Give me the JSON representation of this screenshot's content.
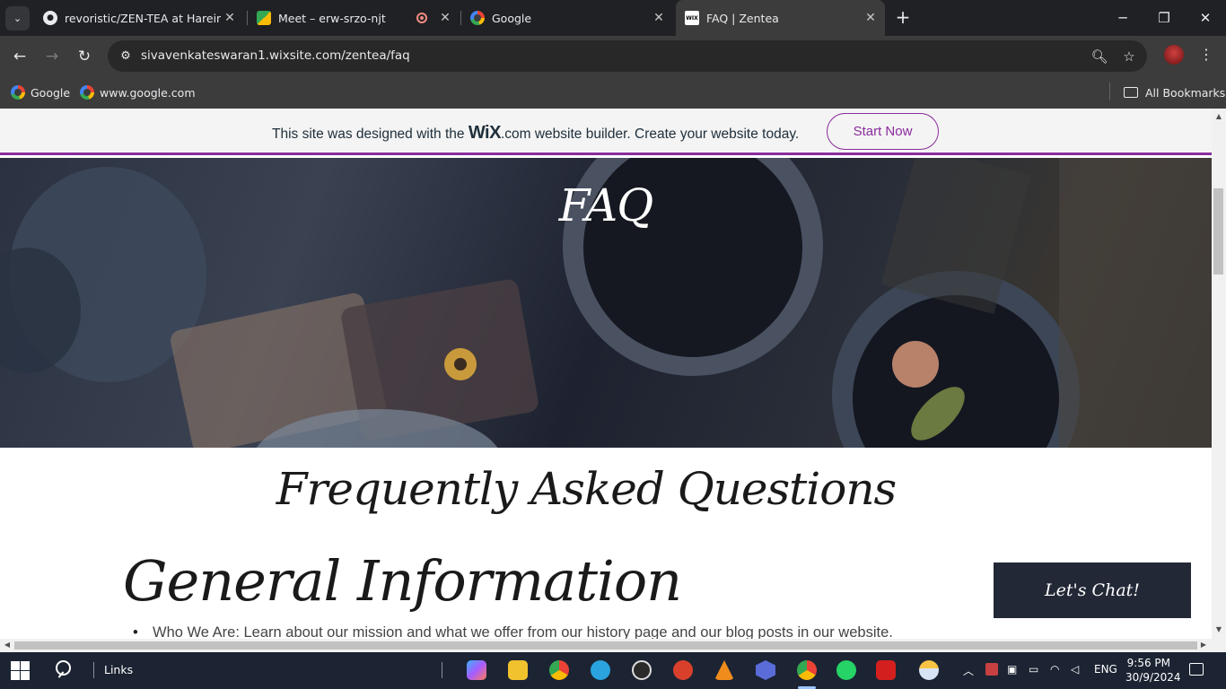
{
  "browser": {
    "tabs": [
      {
        "title": "revoristic/ZEN-TEA at Harein",
        "favicon": "github-icon"
      },
      {
        "title": "Meet – erw-srzo-njt",
        "favicon": "google-meet-icon"
      },
      {
        "title": "Google",
        "favicon": "google-icon"
      },
      {
        "title": "FAQ | Zentea",
        "favicon": "wix-icon",
        "active": true
      }
    ],
    "url": "sivavenkateswaran1.wixsite.com/zentea/faq",
    "bookmarks": [
      "Google",
      "www.google.com"
    ],
    "all_bookmarks": "All Bookmarks"
  },
  "wix_banner": {
    "text_before": "This site was designed with the",
    "logo": "WiX",
    "logo_suffix": ".com",
    "text_after": "website builder. Create your website today.",
    "button": "Start Now",
    "accent": "#8a2c9c"
  },
  "page": {
    "hero_title": "FAQ",
    "heading": "Frequently Asked Questions",
    "section_title": "General Information",
    "bullet_1": "Who We Are: Learn about our mission and what we offer from our history page and our blog posts in our website.",
    "chat_button": "Let's Chat!"
  },
  "taskbar": {
    "links_label": "Links",
    "language": "ENG",
    "time": "9:56 PM",
    "date": "30/9/2024"
  }
}
